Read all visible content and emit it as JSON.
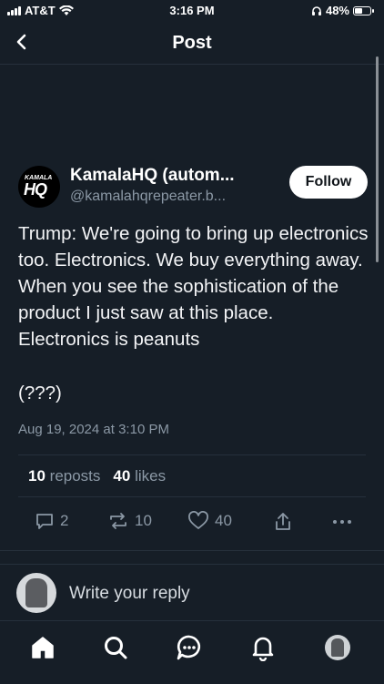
{
  "status_bar": {
    "carrier": "AT&T",
    "time": "3:16 PM",
    "battery_percent": "48%",
    "battery_level": 0.48
  },
  "nav": {
    "title": "Post"
  },
  "post": {
    "author_name": "KamalaHQ (autom...",
    "author_handle": "@kamalahqrepeater.b...",
    "avatar_text_top": "KAMALA",
    "avatar_text_main": "HQ",
    "follow_label": "Follow",
    "text": "Trump: We're going to bring up electronics too. Electronics. We buy everything away. When you see the sophistication of the product I just saw at this place. Electronics is peanuts",
    "text_extra": "(???)",
    "date": "Aug 19, 2024 at 3:10 PM"
  },
  "stats": {
    "reposts_count": "10",
    "reposts_label": "reposts",
    "likes_count": "40",
    "likes_label": "likes"
  },
  "actions": {
    "replies": "2",
    "reposts": "10",
    "likes": "40"
  },
  "reply": {
    "placeholder": "Write your reply"
  },
  "tabs": [
    {
      "icon": "home-icon"
    },
    {
      "icon": "search-icon"
    },
    {
      "icon": "chat-icon"
    },
    {
      "icon": "bell-icon"
    },
    {
      "icon": "profile-avatar"
    }
  ],
  "colors": {
    "background": "#161e27",
    "muted": "#8b98a5",
    "divider": "#26303c"
  }
}
